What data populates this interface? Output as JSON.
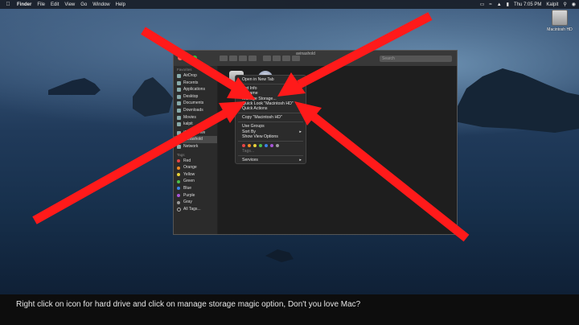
{
  "menubar": {
    "items": [
      "Finder",
      "File",
      "Edit",
      "View",
      "Go",
      "Window",
      "Help"
    ],
    "clock": "Thu 7:05 PM",
    "user": "Kalpit"
  },
  "desktop": {
    "hd_label": "Macintosh HD"
  },
  "finder": {
    "window_title": "avinashold",
    "search_placeholder": "Search",
    "sidebar": {
      "favorites_header": "Favorites",
      "favorites": [
        "AirDrop",
        "Recents",
        "Applications",
        "Desktop",
        "Documents",
        "Downloads",
        "Movies",
        "kalpit"
      ],
      "locations": [
        "iCloud Drive",
        "avinashold",
        "Network"
      ],
      "tags_header": "Tags",
      "tags": [
        {
          "label": "Red",
          "color": "#e64545"
        },
        {
          "label": "Orange",
          "color": "#f08a24"
        },
        {
          "label": "Yellow",
          "color": "#e8d23a"
        },
        {
          "label": "Green",
          "color": "#4cc04c"
        },
        {
          "label": "Blue",
          "color": "#3a83e8"
        },
        {
          "label": "Purple",
          "color": "#a855d8"
        },
        {
          "label": "Gray",
          "color": "#9a9a9a"
        },
        {
          "label": "All Tags...",
          "color": ""
        }
      ]
    }
  },
  "context_menu": {
    "items": [
      "Open in New Tab",
      "Get Info",
      "Rename",
      "Manage Storage...",
      "Quick Look \"Macintosh HD\"",
      "Quick Actions",
      "Copy \"Macintosh HD\"",
      "Use Groups",
      "Sort By",
      "Show View Options",
      "Tags...",
      "Services"
    ],
    "tag_colors": [
      "#e64545",
      "#f08a24",
      "#e8d23a",
      "#4cc04c",
      "#3a83e8",
      "#a855d8",
      "#9a9a9a"
    ]
  },
  "annotation": {
    "arrow_color": "#ff1a1a"
  },
  "caption": {
    "text": "Right click on icon for hard drive and click on manage storage magic option, Don't you love Mac?"
  }
}
